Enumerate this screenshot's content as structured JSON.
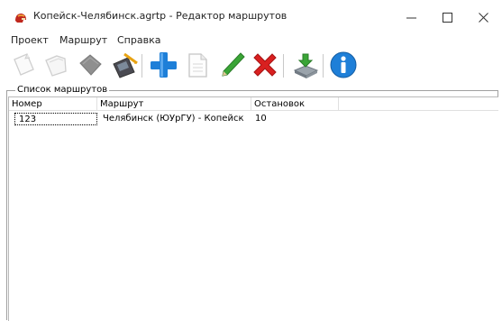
{
  "window": {
    "title": "Копейск-Челябинск.agrtp - Редактор маршрутов",
    "app_icon": "red-helmet-icon"
  },
  "menu": [
    {
      "label": "Проект"
    },
    {
      "label": "Маршрут"
    },
    {
      "label": "Справка"
    }
  ],
  "toolbar": [
    {
      "icon": "new-file-icon"
    },
    {
      "icon": "open-folder-icon"
    },
    {
      "icon": "book-icon"
    },
    {
      "icon": "save-disk-icon"
    },
    {
      "icon": "add-plus-icon"
    },
    {
      "icon": "copy-document-icon"
    },
    {
      "icon": "edit-pencil-icon"
    },
    {
      "icon": "delete-x-icon"
    },
    {
      "icon": "export-download-icon"
    },
    {
      "icon": "info-icon"
    }
  ],
  "routes_group": {
    "label": "Список маршрутов",
    "columns": [
      "Номер",
      "Маршрут",
      "Остановок",
      ""
    ],
    "rows": [
      {
        "number": "123",
        "route": "Челябинск (ЮУрГУ) - Копейск",
        "stops": "10"
      }
    ]
  },
  "colors": {
    "accent_blue": "#1e7fd8",
    "delete_red": "#d92020",
    "pencil_green": "#3aa536"
  }
}
